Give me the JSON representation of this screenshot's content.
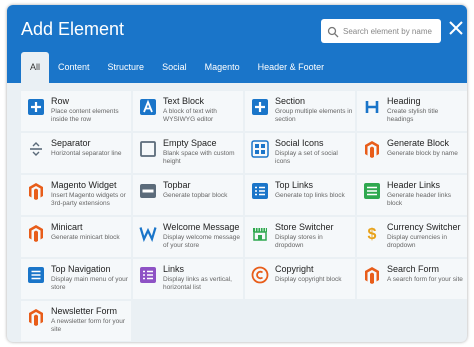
{
  "dialog": {
    "title": "Add Element",
    "search_placeholder": "Search element by name",
    "tabs": [
      {
        "label": "All",
        "active": true
      },
      {
        "label": "Content"
      },
      {
        "label": "Structure"
      },
      {
        "label": "Social"
      },
      {
        "label": "Magento"
      },
      {
        "label": "Header & Footer"
      }
    ]
  },
  "colors": {
    "header": "#1a75c9",
    "body": "#eaf0f4",
    "card": "#f5f8fa",
    "blue_icon": "#1a75c9",
    "orange_magento": "#e85d1a",
    "green_icon": "#2fa84f",
    "purple_icon": "#8e52c5",
    "gray_icon": "#5b6b7a"
  },
  "elements": [
    {
      "name": "Row",
      "description": "Place content elements inside the row",
      "icon": "plus-square-icon"
    },
    {
      "name": "Text Block",
      "description": "A block of text with WYSIWYG editor",
      "icon": "text-a-icon"
    },
    {
      "name": "Section",
      "description": "Group multiple elements in section",
      "icon": "plus-square-icon"
    },
    {
      "name": "Heading",
      "description": "Create stylish title headings",
      "icon": "heading-h-icon"
    },
    {
      "name": "Separator",
      "description": "Horizontal separator line",
      "icon": "separator-icon"
    },
    {
      "name": "Empty Space",
      "description": "Blank space with custom height",
      "icon": "empty-square-icon"
    },
    {
      "name": "Social Icons",
      "description": "Display a set of social icons",
      "icon": "social-icons-icon"
    },
    {
      "name": "Generate Block",
      "description": "Generate block by name",
      "icon": "magento-icon"
    },
    {
      "name": "Magento Widget",
      "description": "Insert Magento widgets or 3rd-party extensions",
      "icon": "magento-icon"
    },
    {
      "name": "Topbar",
      "description": "Generate topbar block",
      "icon": "topbar-icon"
    },
    {
      "name": "Top Links",
      "description": "Generate top links block",
      "icon": "list-icon"
    },
    {
      "name": "Header Links",
      "description": "Generate header links block",
      "icon": "header-links-icon"
    },
    {
      "name": "Minicart",
      "description": "Generate minicart block",
      "icon": "magento-icon"
    },
    {
      "name": "Welcome Message",
      "description": "Display welcome message of your store",
      "icon": "w-letter-icon"
    },
    {
      "name": "Store Switcher",
      "description": "Display stores in dropdown",
      "icon": "store-icon"
    },
    {
      "name": "Currency Switcher",
      "description": "Display currencies in dropdown",
      "icon": "dollar-icon"
    },
    {
      "name": "Top Navigation",
      "description": "Display main menu of your store",
      "icon": "menu-icon"
    },
    {
      "name": "Links",
      "description": "Display links as vertical, horizontal list",
      "icon": "list-icon"
    },
    {
      "name": "Copyright",
      "description": "Display copyright block",
      "icon": "copyright-icon"
    },
    {
      "name": "Search Form",
      "description": "A search form for your site",
      "icon": "magento-icon"
    },
    {
      "name": "Newsletter Form",
      "description": "A newsletter form for your site",
      "icon": "magento-icon"
    }
  ]
}
